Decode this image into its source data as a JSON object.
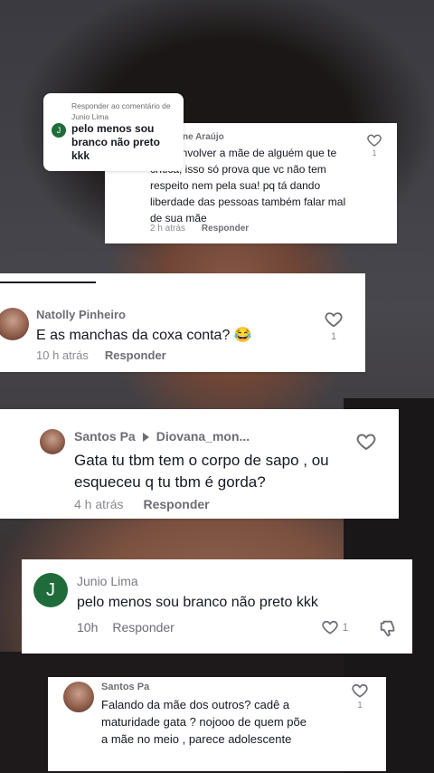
{
  "reply_sticker": {
    "header": "Responder ao comentário de",
    "author": "Junio Lima",
    "avatar_letter": "J",
    "text": "pelo menos sou branco não preto kkk"
  },
  "comments": [
    {
      "username": "ne Araújo",
      "text": "io vc envolver a mãe de alguém que te crítica, isso só prova que vc não tem respeito nem pela sua! pq tá dando liberdade das pessoas também falar mal de sua mãe",
      "time": "2 h atrás",
      "reply": "Responder",
      "likes": "1"
    },
    {
      "username": "Natolly Pinheiro",
      "text": "E as manchas da coxa conta? 😂",
      "time": "10 h atrás",
      "reply": "Responder",
      "likes": "1"
    },
    {
      "username": "Santos Pa",
      "reply_to": "Diovana_mon...",
      "text": "Gata tu tbm tem o corpo de sapo , ou esqueceu q tu tbm é gorda?",
      "time": "4 h atrás",
      "reply": "Responder"
    },
    {
      "username": "Junio Lima",
      "avatar_letter": "J",
      "text": "pelo menos sou branco não preto kkk",
      "time": "10h",
      "reply": "Responder",
      "likes": "1"
    },
    {
      "username": "Santos Pa",
      "text": "Falando da mãe dos outros? cadê a maturidade gata ? nojooo de quem põe a mãe no meio , parece adolescente",
      "likes": "1"
    }
  ],
  "colors": {
    "card_bg": "#ffffff",
    "text": "#161823",
    "secondary": "#8a8b91",
    "avatar_green": "#1f6b3a"
  }
}
